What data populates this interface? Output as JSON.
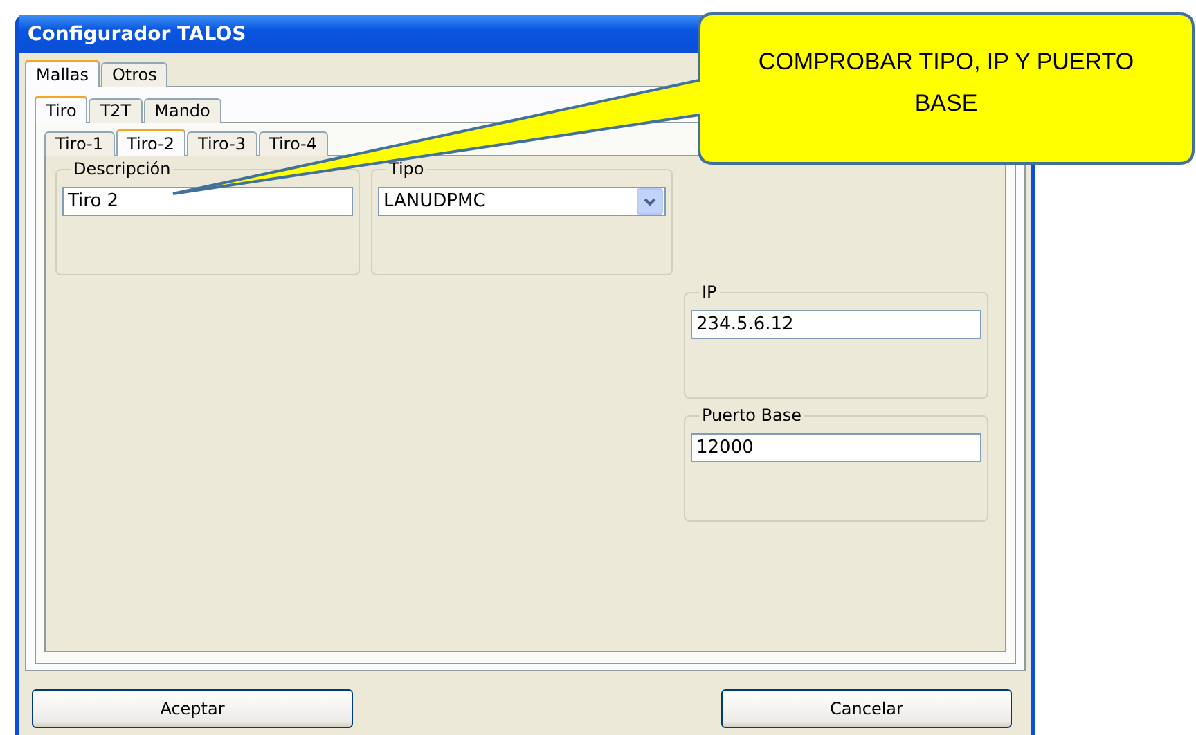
{
  "window": {
    "title": "Configurador TALOS"
  },
  "tabs": [
    {
      "label": "Mallas",
      "selected": true
    },
    {
      "label": "Otros",
      "selected": false
    }
  ],
  "subtabs": [
    {
      "label": "Tiro",
      "selected": true
    },
    {
      "label": "T2T",
      "selected": false
    },
    {
      "label": "Mando",
      "selected": false
    }
  ],
  "shot_tabs": [
    {
      "label": "Tiro-1",
      "selected": false
    },
    {
      "label": "Tiro-2",
      "selected": true
    },
    {
      "label": "Tiro-3",
      "selected": false
    },
    {
      "label": "Tiro-4",
      "selected": false
    }
  ],
  "groups": [
    {
      "label": "Descripción",
      "kind": "text",
      "value": "Tiro 2"
    },
    {
      "label": "Tipo",
      "kind": "dropdown",
      "value": "LANUDPMC"
    },
    {
      "label": "IP",
      "kind": "text",
      "value": "234.5.6.12"
    },
    {
      "label": "Puerto Base",
      "kind": "text",
      "value": "12000"
    }
  ],
  "buttons": [
    {
      "label": "Aceptar"
    },
    {
      "label": "Cancelar"
    }
  ],
  "callout": {
    "text": "COMPROBAR TIPO, IP Y PUERTO BASE"
  }
}
